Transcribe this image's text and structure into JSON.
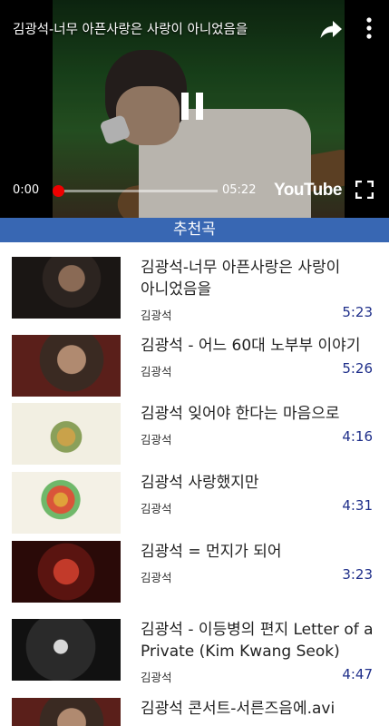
{
  "player": {
    "title": "김광석-너무 아픈사랑은 사랑이 아니었음을",
    "current_time": "0:00",
    "total_time": "05:22",
    "progress_fraction": 0.02,
    "brand": "YouTube",
    "icons": {
      "share": "share-icon",
      "more": "more-vert-icon",
      "pause": "pause-icon",
      "fullscreen": "fullscreen-icon"
    },
    "accent_color": "#e00000"
  },
  "section": {
    "title": "추천곡",
    "color": "#3867b3"
  },
  "videos": [
    {
      "title_lines": [
        "김광석-너무 아픈사랑은 사랑이",
        "아니었음을"
      ],
      "channel": "김광석",
      "duration": "5:23"
    },
    {
      "title_lines": [
        "김광석 - 어느 60대 노부부 이야기"
      ],
      "channel": "김광석",
      "duration": "5:26"
    },
    {
      "title_lines": [
        "김광석 잊어야 한다는 마음으로"
      ],
      "channel": "김광석",
      "duration": "4:16"
    },
    {
      "title_lines": [
        "김광석 사랑했지만"
      ],
      "channel": "김광석",
      "duration": "4:31"
    },
    {
      "title_lines": [
        "김광석 = 먼지가 되어"
      ],
      "channel": "김광석",
      "duration": "3:23"
    },
    {
      "title_lines": [
        "김광석 - 이등병의 편지 Letter of a",
        "Private (Kim Kwang Seok)"
      ],
      "channel": "김광석",
      "duration": "4:47"
    },
    {
      "title_lines": [
        "김광석 콘서트-서른즈음에.avi"
      ],
      "channel": "",
      "duration": ""
    }
  ]
}
